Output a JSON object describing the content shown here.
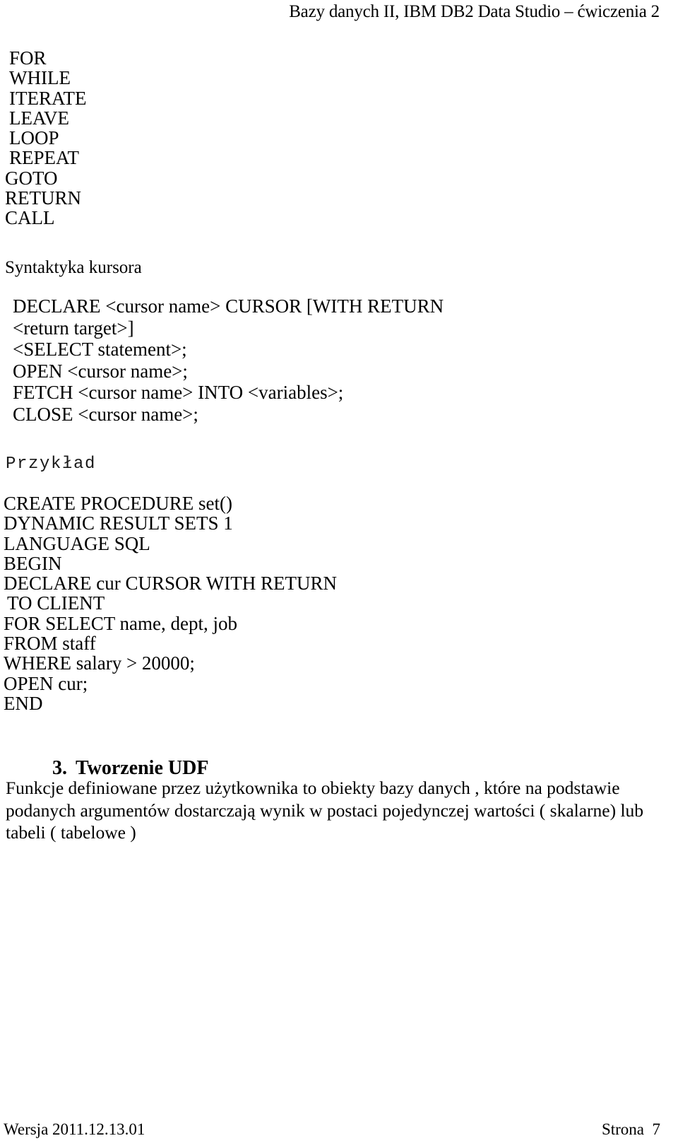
{
  "header": {
    "title": "Bazy danych II, IBM DB2 Data Studio – ćwiczenia 2"
  },
  "keywords": {
    "items": [
      "FOR",
      "WHILE",
      "ITERATE",
      "LEAVE",
      "LOOP",
      "REPEAT",
      "GOTO",
      "RETURN",
      "CALL"
    ]
  },
  "cursor_section": {
    "heading": "Syntaktyka kursora",
    "lines": [
      "DECLARE <cursor name> CURSOR [WITH RETURN",
      "<return target>]",
      "<SELECT statement>;",
      "OPEN <cursor name>;",
      "FETCH <cursor name> INTO <variables>;",
      "CLOSE <cursor name>;"
    ]
  },
  "example": {
    "label": "Przykład",
    "lines": [
      "CREATE PROCEDURE set()",
      "DYNAMIC RESULT SETS 1",
      "LANGUAGE SQL",
      "BEGIN",
      "DECLARE cur CURSOR WITH RETURN",
      "TO CLIENT",
      "FOR SELECT name, dept, job",
      "FROM staff",
      "WHERE salary > 20000;",
      "OPEN cur;",
      "END"
    ]
  },
  "udf_section": {
    "number": "3.",
    "title": "Tworzenie UDF",
    "paragraph_lines": [
      "Funkcje definiowane przez użytkownika to obiekty bazy danych , które na podstawie",
      "podanych argumentów dostarczają wynik w postaci pojedynczej wartości ( skalarne) lub",
      "tabeli ( tabelowe )"
    ]
  },
  "footer": {
    "version": "Wersja 2011.12.13.01",
    "page": "Strona  7"
  }
}
